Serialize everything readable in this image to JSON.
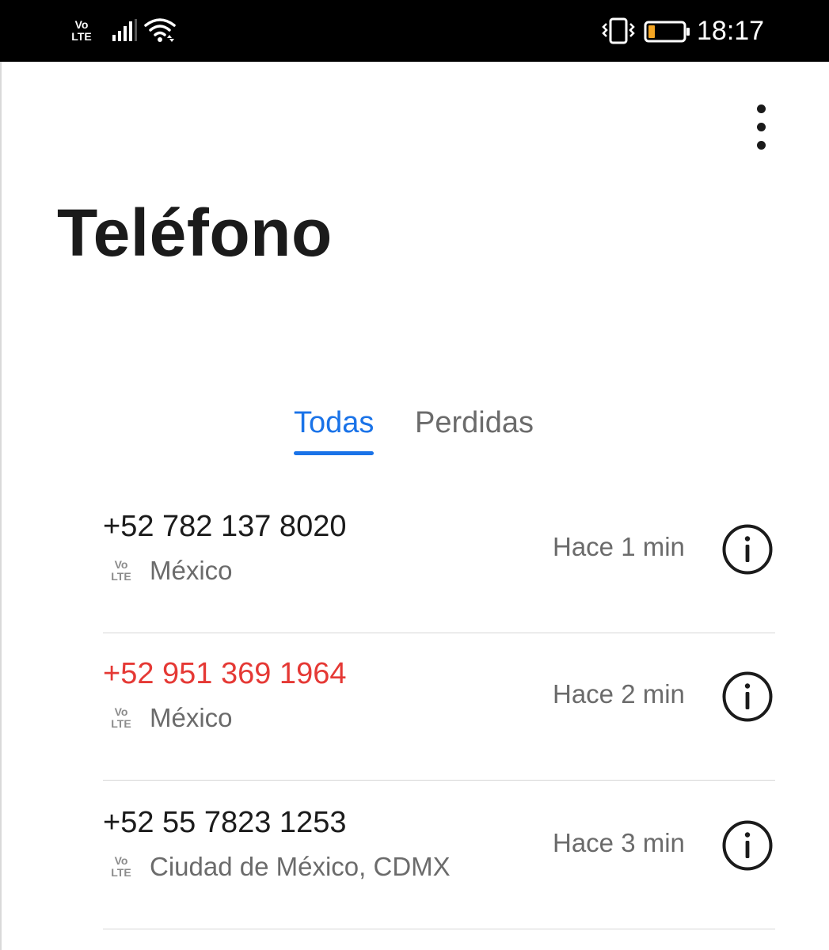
{
  "status_bar": {
    "volte_line1": "Vo",
    "volte_line2": "LTE",
    "time": "18:17",
    "icons": [
      "signal-icon",
      "wifi-icon",
      "vibrate-icon",
      "battery-icon"
    ],
    "battery_level": 0.2,
    "battery_color": "#f5a623"
  },
  "app": {
    "title": "Teléfono",
    "menu_icon": "more-vert-icon"
  },
  "tabs": [
    {
      "label": "Todas",
      "selected": true
    },
    {
      "label": "Perdidas",
      "selected": false
    }
  ],
  "calls": [
    {
      "number": "+52 782 137 8020",
      "missed": false,
      "volte_line1": "Vo",
      "volte_line2": "LTE",
      "location": "México",
      "time": "Hace 1 min"
    },
    {
      "number": "+52 951 369 1964",
      "missed": true,
      "volte_line1": "Vo",
      "volte_line2": "LTE",
      "location": "México",
      "time": "Hace 2 min"
    },
    {
      "number": "+52 55 7823 1253",
      "missed": false,
      "volte_line1": "Vo",
      "volte_line2": "LTE",
      "location": "Ciudad de México, CDMX",
      "time": "Hace 3 min"
    }
  ],
  "colors": {
    "accent": "#1a73e8",
    "missed": "#e53935",
    "primary_text": "#1b1b1b",
    "secondary_text": "#6b6b6b"
  }
}
